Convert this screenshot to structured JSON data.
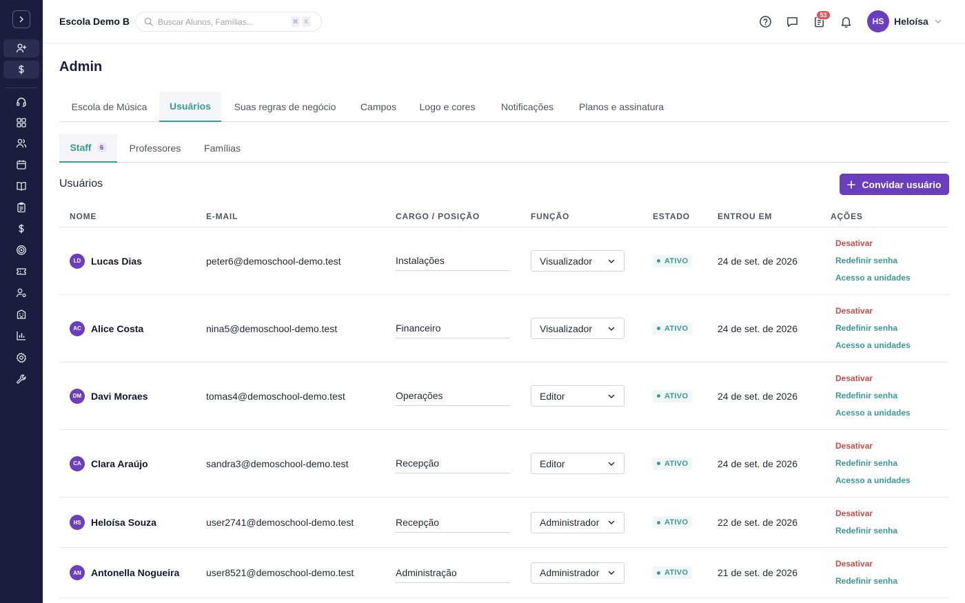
{
  "app": {
    "school_name": "Escola Demo B"
  },
  "search": {
    "placeholder": "Buscar Alunos, Famílias...",
    "kbd1": "⌘",
    "kbd2": "K"
  },
  "topbar": {
    "notification_count": "53",
    "user_initials": "HS",
    "user_name": "Heloísa"
  },
  "page": {
    "title": "Admin"
  },
  "tabs": [
    {
      "label": "Escola de Música"
    },
    {
      "label": "Usuários",
      "active": true
    },
    {
      "label": "Suas regras de negócio"
    },
    {
      "label": "Campos"
    },
    {
      "label": "Logo e cores"
    },
    {
      "label": "Notificações"
    },
    {
      "label": "Planos e assinatura"
    }
  ],
  "subtabs": [
    {
      "label": "Staff",
      "count": "6",
      "active": true
    },
    {
      "label": "Professores"
    },
    {
      "label": "Famílias"
    }
  ],
  "section": {
    "title": "Usuários",
    "invite_label": "Convidar usuário"
  },
  "table": {
    "headers": [
      "NOME",
      "E-MAIL",
      "CARGO / POSIÇÃO",
      "FUNÇÃO",
      "ESTADO",
      "ENTROU EM",
      "AÇÕES"
    ],
    "rows": [
      {
        "initials": "LD",
        "name": "Lucas Dias",
        "email": "peter6@demoschool-demo.test",
        "cargo": "Instalações",
        "funcao": "Visualizador",
        "estado": "ATIVO",
        "entrou": "24 de set. de 2026",
        "actions": [
          "Desativar",
          "Redefinir senha",
          "Acesso a unidades"
        ]
      },
      {
        "initials": "AC",
        "name": "Alice Costa",
        "email": "nina5@demoschool-demo.test",
        "cargo": "Financeiro",
        "funcao": "Visualizador",
        "estado": "ATIVO",
        "entrou": "24 de set. de 2026",
        "actions": [
          "Desativar",
          "Redefinir senha",
          "Acesso a unidades"
        ]
      },
      {
        "initials": "DM",
        "name": "Davi Moraes",
        "email": "tomas4@demoschool-demo.test",
        "cargo": "Operações",
        "funcao": "Editor",
        "estado": "ATIVO",
        "entrou": "24 de set. de 2026",
        "actions": [
          "Desativar",
          "Redefinir senha",
          "Acesso a unidades"
        ]
      },
      {
        "initials": "CA",
        "name": "Clara Araújo",
        "email": "sandra3@demoschool-demo.test",
        "cargo": "Recepção",
        "funcao": "Editor",
        "estado": "ATIVO",
        "entrou": "24 de set. de 2026",
        "actions": [
          "Desativar",
          "Redefinir senha",
          "Acesso a unidades"
        ]
      },
      {
        "initials": "HS",
        "name": "Heloísa Souza",
        "email": "user2741@demoschool-demo.test",
        "cargo": "Recepção",
        "funcao": "Administrador",
        "estado": "ATIVO",
        "entrou": "22 de set. de 2026",
        "actions": [
          "Desativar",
          "Redefinir senha"
        ]
      },
      {
        "initials": "AN",
        "name": "Antonella Nogueira",
        "email": "user8521@demoschool-demo.test",
        "cargo": "Administração",
        "funcao": "Administrador",
        "estado": "ATIVO",
        "entrou": "21 de set. de 2026",
        "actions": [
          "Desativar",
          "Redefinir senha"
        ]
      }
    ]
  },
  "colors": {
    "sidebar_bg": "#1a1d3b",
    "accent_purple": "#6a3fbd",
    "accent_teal": "#3a9a94",
    "danger": "#d14a4a"
  },
  "sidebar_icons": [
    "chevron-right-icon",
    "user-plus-icon",
    "dollar-icon",
    "headset-icon",
    "grid-icon",
    "users-icon",
    "calendar-icon",
    "book-icon",
    "clipboard-icon",
    "dollar-icon",
    "target-icon",
    "ticket-icon",
    "user-gear-icon",
    "building-icon",
    "bar-chart-icon",
    "settings-icon",
    "wrench-icon"
  ]
}
